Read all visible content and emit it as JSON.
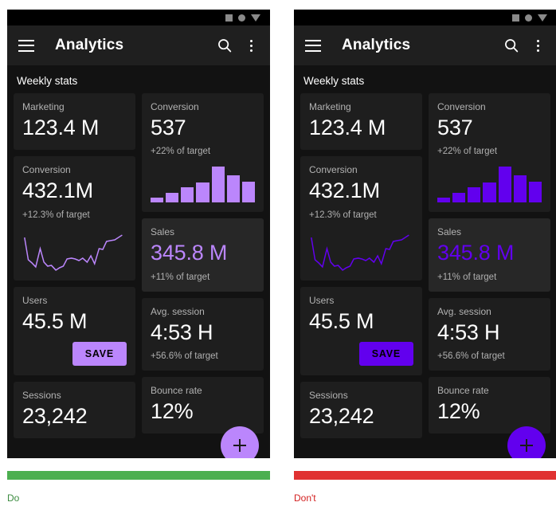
{
  "panels": [
    {
      "key": "do",
      "verdict_label": "Do",
      "verdict_color": "#4CAF50",
      "accent": "#BB86FC",
      "statusbar": {
        "icons": [
          "square-icon",
          "circle-icon",
          "triangle-down-icon"
        ]
      },
      "appbar": {
        "menu_icon": "hamburger-menu-icon",
        "title": "Analytics",
        "search_icon": "search-icon",
        "overflow_icon": "more-vert-icon"
      },
      "section_title": "Weekly stats",
      "cards": {
        "marketing": {
          "label": "Marketing",
          "value": "123.4 M"
        },
        "conversion_left": {
          "label": "Conversion",
          "value": "432.1M",
          "sub": "+12.3% of target"
        },
        "users": {
          "label": "Users",
          "value": "45.5 M",
          "button": "SAVE"
        },
        "sessions": {
          "label": "Sessions",
          "value": "23,242"
        },
        "conversion_right": {
          "label": "Conversion",
          "value": "537",
          "sub": "+22% of target"
        },
        "sales": {
          "label": "Sales",
          "value": "345.8 M",
          "sub": "+11% of target"
        },
        "avg_session": {
          "label": "Avg. session",
          "value": "4:53 H",
          "sub": "+56.6% of target"
        },
        "bounce_rate": {
          "label": "Bounce rate",
          "value": "12%"
        }
      },
      "fab": {
        "icon": "plus-icon"
      }
    },
    {
      "key": "dont",
      "verdict_label": "Don't",
      "verdict_color": "#E03131",
      "accent": "#6200EE",
      "statusbar": {
        "icons": [
          "square-icon",
          "circle-icon",
          "triangle-down-icon"
        ]
      },
      "appbar": {
        "menu_icon": "hamburger-menu-icon",
        "title": "Analytics",
        "search_icon": "search-icon",
        "overflow_icon": "more-vert-icon"
      },
      "section_title": "Weekly stats",
      "cards": {
        "marketing": {
          "label": "Marketing",
          "value": "123.4 M"
        },
        "conversion_left": {
          "label": "Conversion",
          "value": "432.1M",
          "sub": "+12.3% of target"
        },
        "users": {
          "label": "Users",
          "value": "45.5 M",
          "button": "SAVE"
        },
        "sessions": {
          "label": "Sessions",
          "value": "23,242"
        },
        "conversion_right": {
          "label": "Conversion",
          "value": "537",
          "sub": "+22% of target"
        },
        "sales": {
          "label": "Sales",
          "value": "345.8 M",
          "sub": "+11% of target"
        },
        "avg_session": {
          "label": "Avg. session",
          "value": "4:53 H",
          "sub": "+56.6% of target"
        },
        "bounce_rate": {
          "label": "Bounce rate",
          "value": "12%"
        }
      },
      "fab": {
        "icon": "plus-icon"
      }
    }
  ],
  "chart_data": [
    {
      "type": "bar",
      "title": "Conversion",
      "categories": [
        "1",
        "2",
        "3",
        "4",
        "5",
        "6",
        "7"
      ],
      "values": [
        14,
        26,
        40,
        52,
        95,
        72,
        55
      ],
      "xlabel": "",
      "ylabel": "",
      "ylim": [
        0,
        100
      ],
      "grid": false,
      "legend": "none"
    },
    {
      "type": "line",
      "title": "Conversion",
      "x": [
        0,
        1,
        2,
        3,
        4,
        5,
        6,
        7,
        8,
        9,
        10,
        11,
        12,
        13,
        14,
        15,
        16,
        17,
        18,
        19,
        20,
        21,
        22,
        23,
        24,
        25
      ],
      "values": [
        74,
        38,
        30,
        24,
        56,
        34,
        26,
        28,
        14,
        20,
        24,
        40,
        42,
        40,
        36,
        42,
        30,
        46,
        28,
        56,
        54,
        70,
        72,
        74,
        78,
        82
      ],
      "xlabel": "",
      "ylabel": "",
      "ylim": [
        0,
        100
      ],
      "grid": false,
      "legend": "none"
    }
  ]
}
